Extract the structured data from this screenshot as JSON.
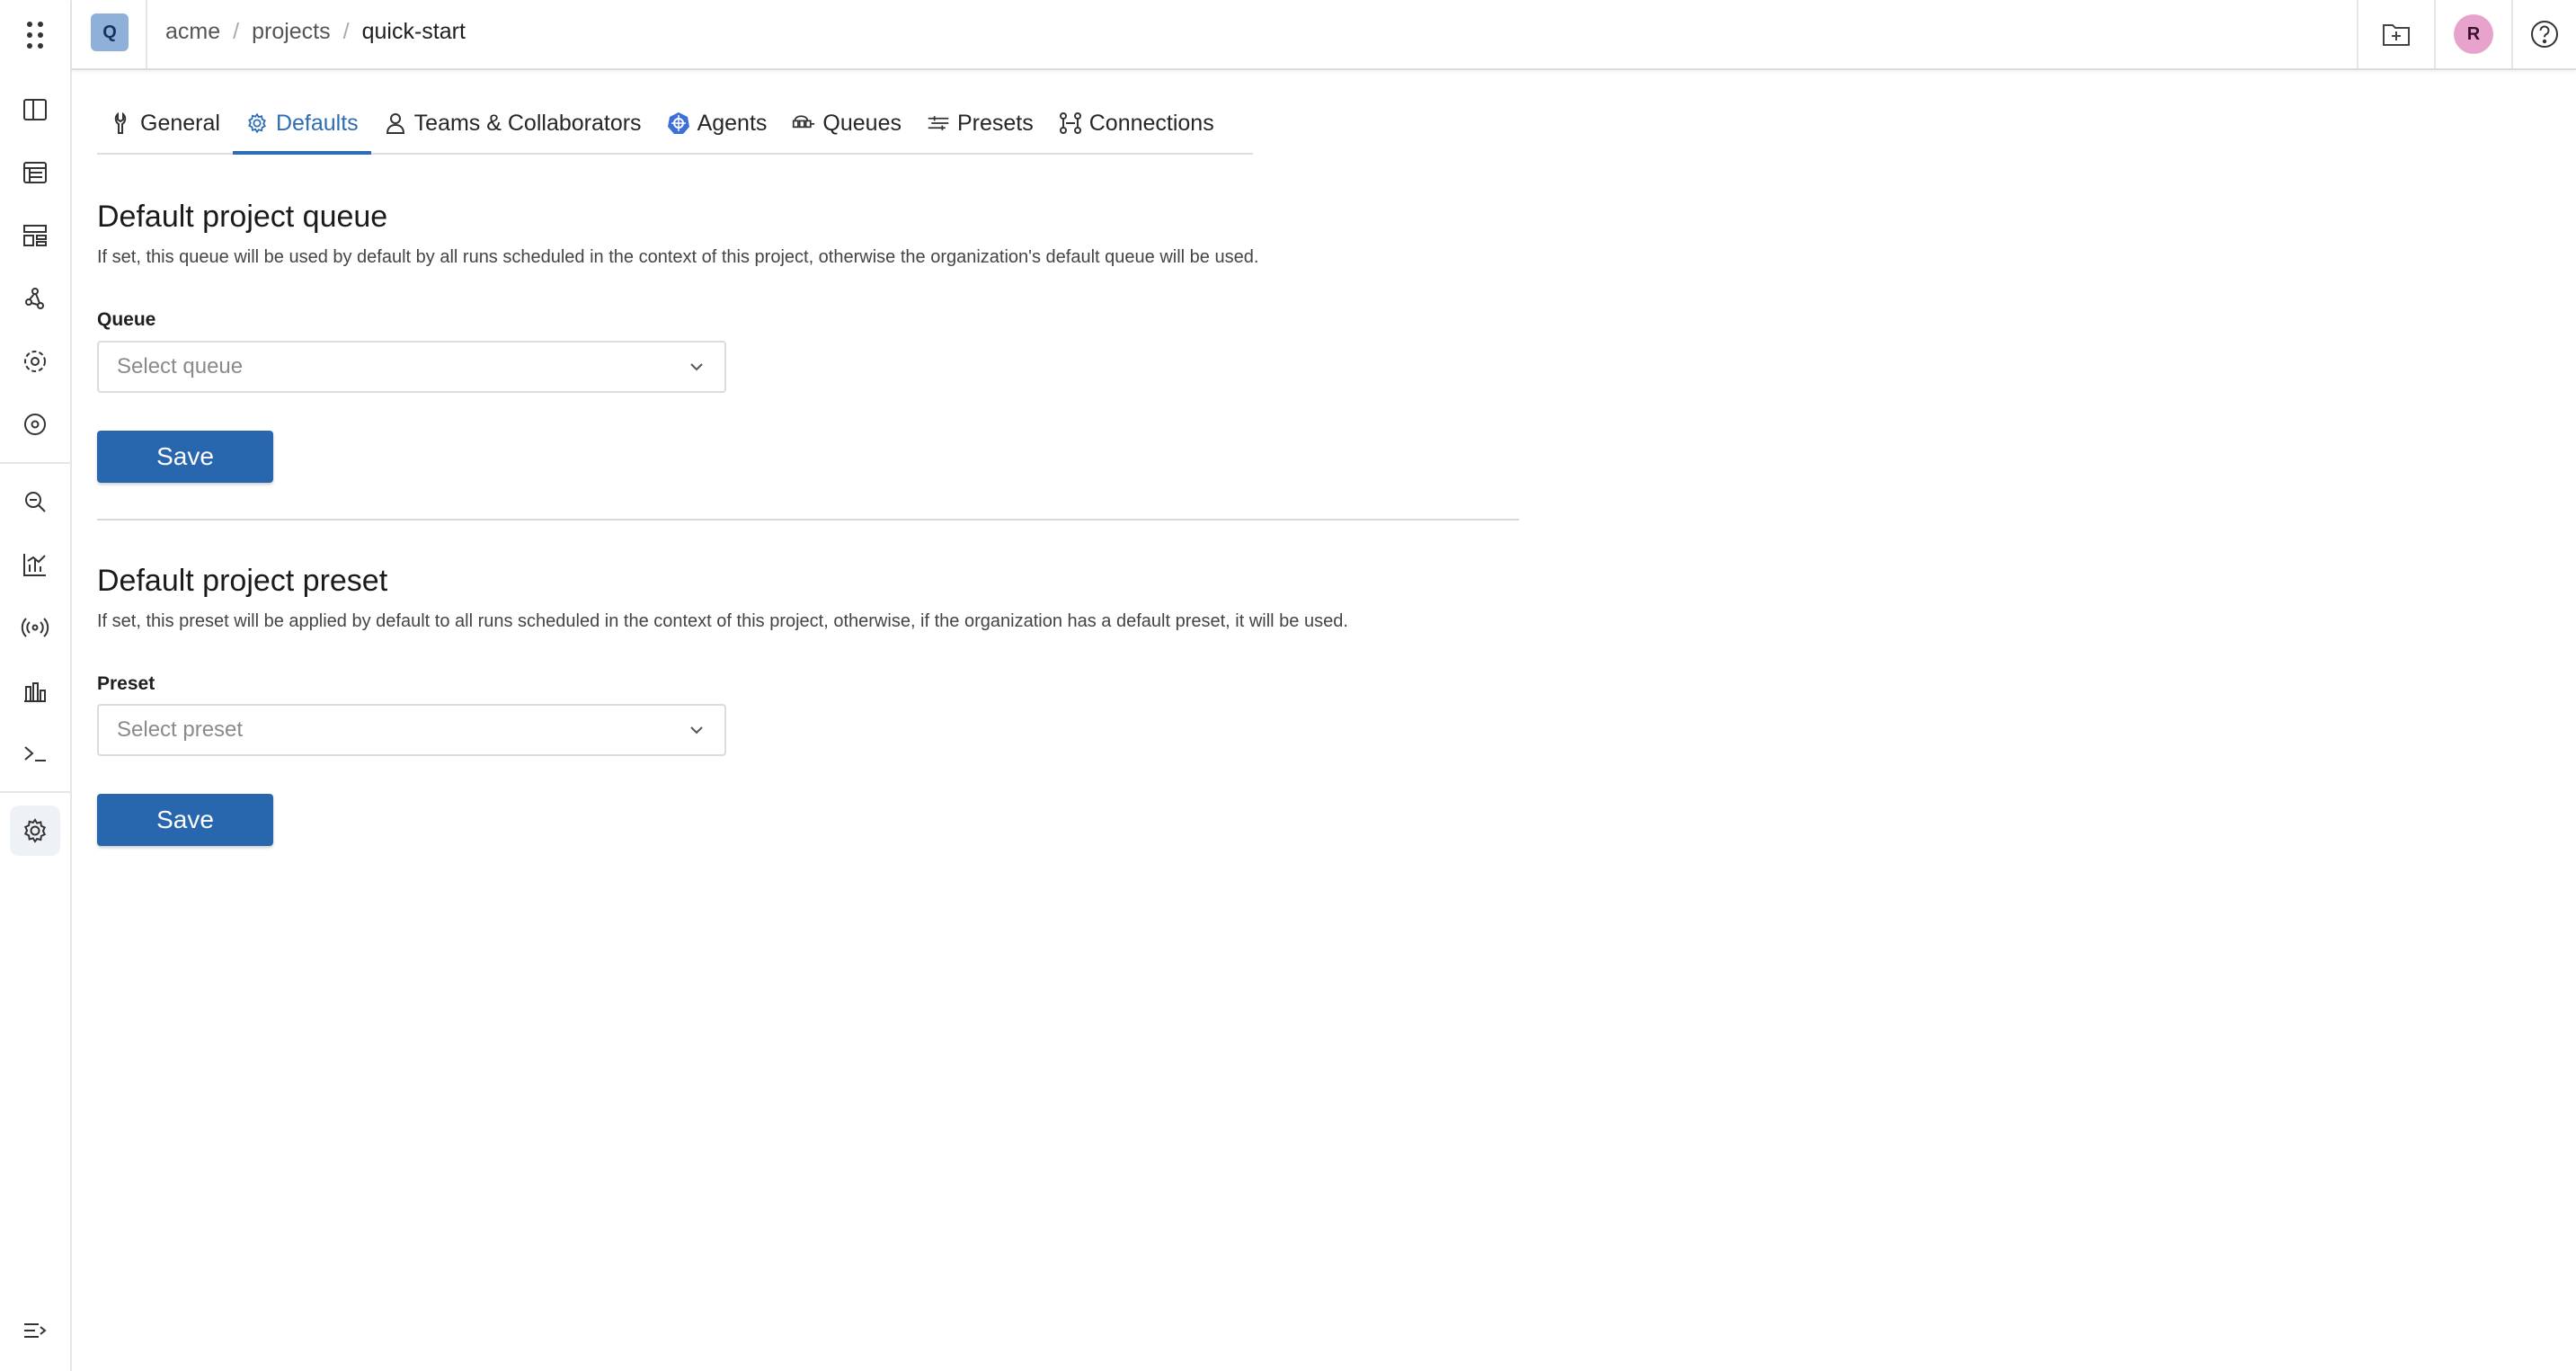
{
  "header": {
    "project_initial": "Q",
    "breadcrumb": [
      "acme",
      "projects",
      "quick-start"
    ],
    "breadcrumb_separator": "/",
    "user_initial": "R"
  },
  "sidebar": {
    "items": [
      "dashboard-icon",
      "runs-icon",
      "components-icon",
      "pipelines-icon",
      "agents-icon",
      "search-icon",
      "metrics-icon",
      "broadcast-icon",
      "charts-icon",
      "terminal-icon",
      "settings-icon",
      "collapse-menu-icon"
    ],
    "active": "settings-icon"
  },
  "tabs": [
    {
      "label": "General",
      "icon": "wrench-icon"
    },
    {
      "label": "Defaults",
      "icon": "gear-icon",
      "active": true
    },
    {
      "label": "Teams & Collaborators",
      "icon": "user-icon"
    },
    {
      "label": "Agents",
      "icon": "helm-icon"
    },
    {
      "label": "Queues",
      "icon": "queue-icon"
    },
    {
      "label": "Presets",
      "icon": "preset-icon"
    },
    {
      "label": "Connections",
      "icon": "connections-icon"
    }
  ],
  "queue_section": {
    "title": "Default project queue",
    "description": "If set, this queue will be used by default by all runs scheduled in the context of this project, otherwise the organization's default queue will be used.",
    "field_label": "Queue",
    "placeholder": "Select queue",
    "save_label": "Save"
  },
  "preset_section": {
    "title": "Default project preset",
    "description": "If set, this preset will be applied by default to all runs scheduled in the context of this project, otherwise, if the organization has a default preset, it will be used.",
    "field_label": "Preset",
    "placeholder": "Select preset",
    "save_label": "Save"
  },
  "colors": {
    "accent": "#2d6db5",
    "button": "#2866ad",
    "project_avatar": "#8fb0d9",
    "user_avatar": "#e8a3cc"
  }
}
